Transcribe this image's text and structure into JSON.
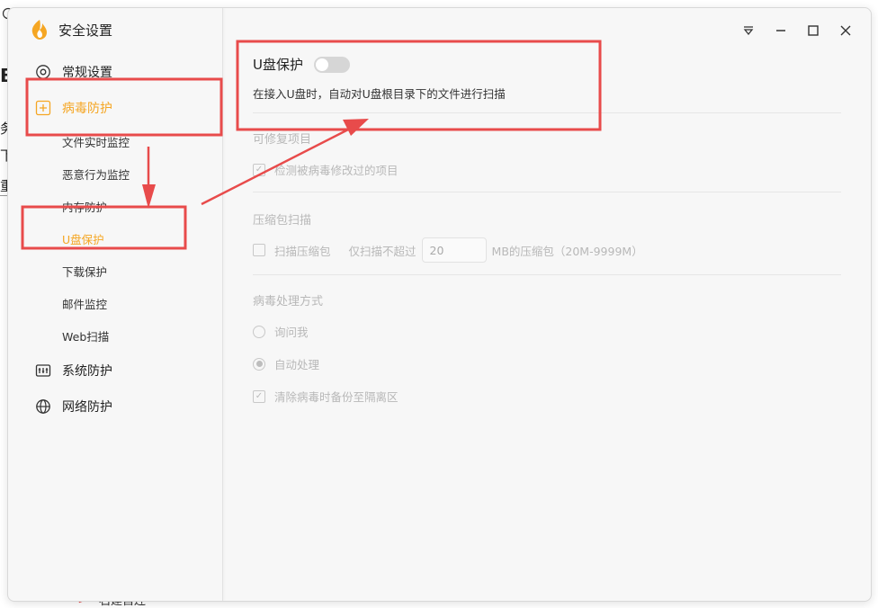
{
  "background": {
    "fragments": [
      "B",
      "务",
      "下",
      "重"
    ],
    "bottom_fragment": "石建自连"
  },
  "app": {
    "title": "安全设置"
  },
  "sidebar": {
    "items": [
      {
        "label": "常规设置",
        "icon": "gear-icon"
      },
      {
        "label": "病毒防护",
        "icon": "plus-square-icon"
      },
      {
        "label": "系统防护",
        "icon": "system-equalizer-icon"
      },
      {
        "label": "网络防护",
        "icon": "globe-icon"
      }
    ],
    "sub_items": [
      {
        "label": "文件实时监控"
      },
      {
        "label": "恶意行为监控"
      },
      {
        "label": "内存防护"
      },
      {
        "label": "U盘保护"
      },
      {
        "label": "下载保护"
      },
      {
        "label": "邮件监控"
      },
      {
        "label": "Web扫描"
      }
    ]
  },
  "window_controls": {
    "icons": [
      "menu-dropdown-icon",
      "minimize-icon",
      "maximize-icon",
      "close-icon"
    ]
  },
  "content": {
    "usb": {
      "title": "U盘保护",
      "toggle_on": false,
      "description": "在接入U盘时，自动对U盘根目录下的文件进行扫描"
    },
    "repairable": {
      "title": "可修复项目",
      "option": "检测被病毒修改过的项目"
    },
    "archive": {
      "title": "压缩包扫描",
      "option": "扫描压缩包",
      "limit_prefix": "仅扫描不超过",
      "limit_value": "20",
      "limit_suffix": "MB的压缩包（20M-9999M）"
    },
    "handling": {
      "title": "病毒处理方式",
      "ask": "询问我",
      "auto": "自动处理",
      "backup": "清除病毒时备份至隔离区"
    }
  },
  "colors": {
    "accent": "#f5a623",
    "annotation": "#e84b4b",
    "disabled_text": "#b8b8b8"
  }
}
